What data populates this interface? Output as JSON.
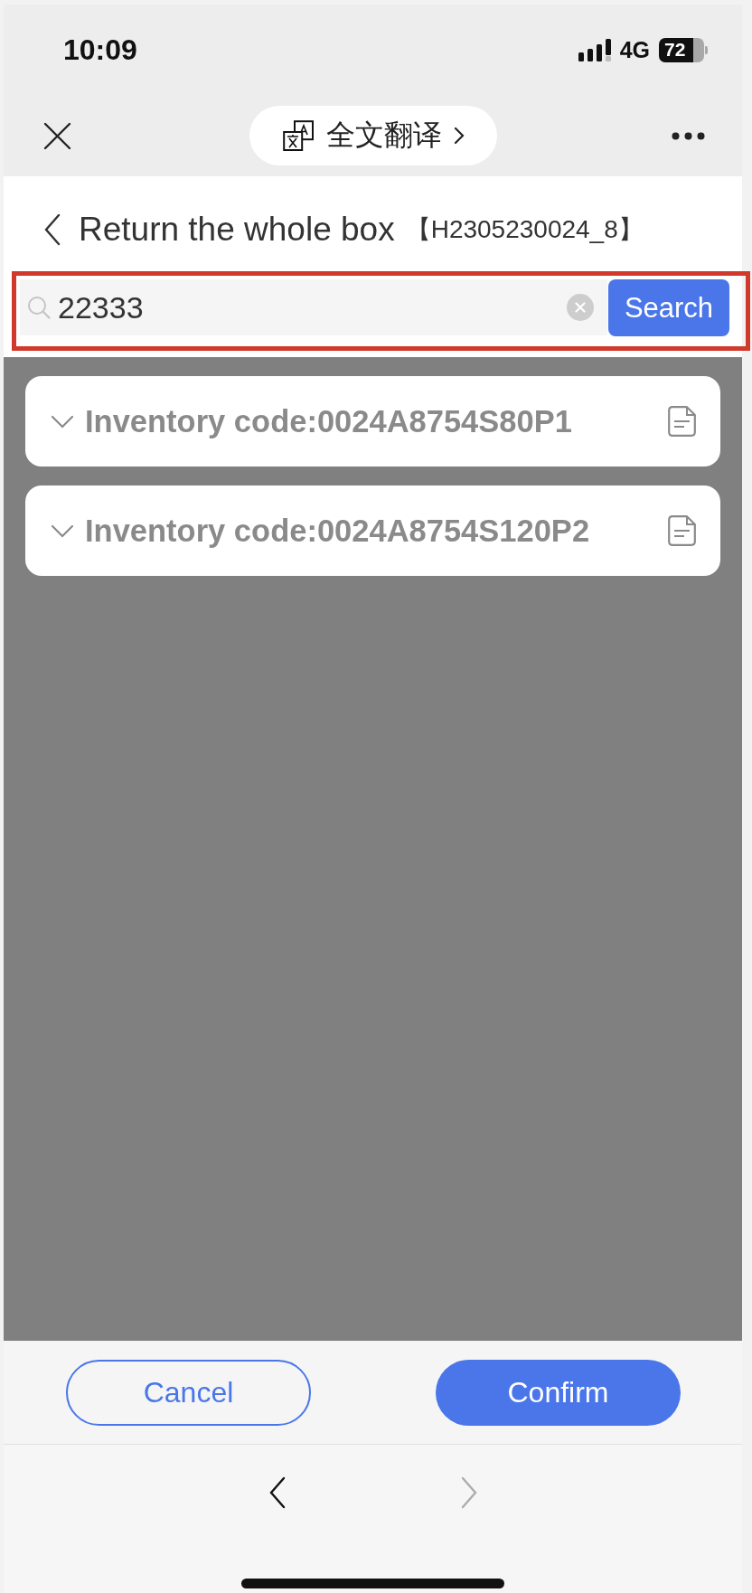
{
  "status_bar": {
    "time": "10:09",
    "network": "4G",
    "battery": "72"
  },
  "top_bar": {
    "translate_label": "全文翻译"
  },
  "header": {
    "title": "Return the whole box",
    "order_code": "【H2305230024_8】"
  },
  "search": {
    "value": "22333",
    "button": "Search",
    "highlighted": true
  },
  "items": [
    {
      "label": "Inventory code:0024A8754S80P1"
    },
    {
      "label": "Inventory code:0024A8754S120P2"
    }
  ],
  "actions": [
    {
      "kind": "cancel",
      "label": "Cancel"
    },
    {
      "kind": "confirm",
      "label": "Confirm"
    }
  ],
  "browser_nav": [
    {
      "kind": "back",
      "disabled": false
    },
    {
      "kind": "forward",
      "disabled": true
    }
  ]
}
